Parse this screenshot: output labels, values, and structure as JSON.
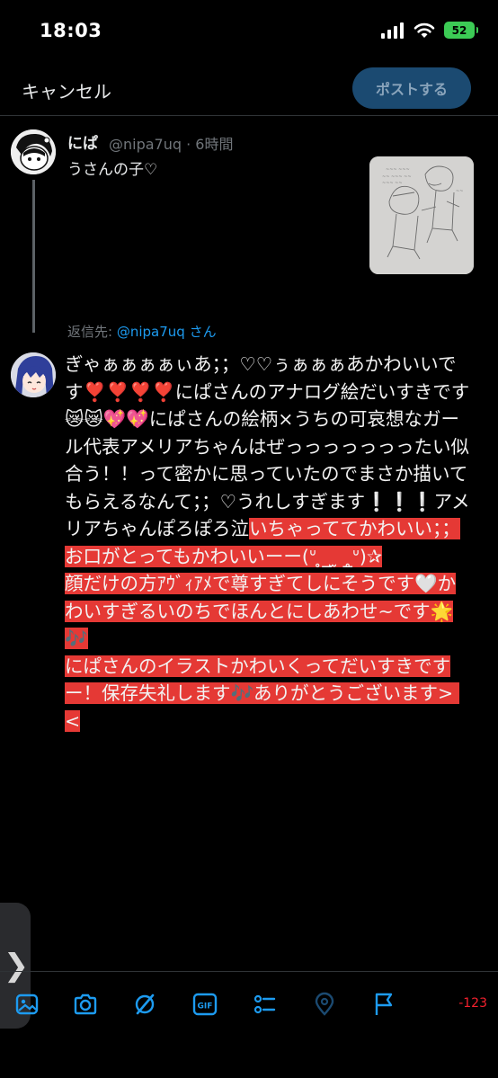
{
  "status_bar": {
    "time": "18:03",
    "battery": "52"
  },
  "header": {
    "cancel_label": "キャンセル",
    "post_label": "ポストする"
  },
  "original_post": {
    "name": "にぱ",
    "meta": "@nipa7uq · 6時間",
    "text": "うさんの子♡"
  },
  "reply": {
    "prefix": "返信先: ",
    "handle": "@nipa7uq",
    "suffix": " さん"
  },
  "compose": {
    "text_plain": "ぎゃぁぁぁぁぃあ；；♡♡ぅぁぁぁあかわいいです❣️❣️❣️❣️にぱさんのアナログ絵だいすきです😿😿💖💖にぱさんの絵柄×うちの可哀想なガール代表アメリアちゃんはぜっっっっっっったい似合う！！って密かに思っていたのでまさか描いてもらえるなんて；；♡うれしすぎます❕❕❕アメリアちゃんぽろぽろ泣",
    "text_highlight": "いちゃっててかわいい；；お口がとってもかわいいーー(ᐡ ̥_ ̫ _̥ᐡ)✰\n顔だけの方ｱｳﾞｨｱﾒで尊すぎてしにそうです🤍かわいすぎるいのちでほんとにしあわせ~です🌟🎶\nにぱさんのイラストかわいくってだいすきですー！保存失礼します🎶ありがとうございます> <"
  },
  "toolbar": {
    "icons": [
      "image-icon",
      "camera-icon",
      "grok-icon",
      "gif-icon",
      "poll-icon",
      "location-icon",
      "flag-icon"
    ],
    "gif_label": "GIF",
    "char_count": "-123"
  },
  "colors": {
    "accent": "#1d9bf0",
    "highlight": "#e53935",
    "error": "#f4212e"
  }
}
